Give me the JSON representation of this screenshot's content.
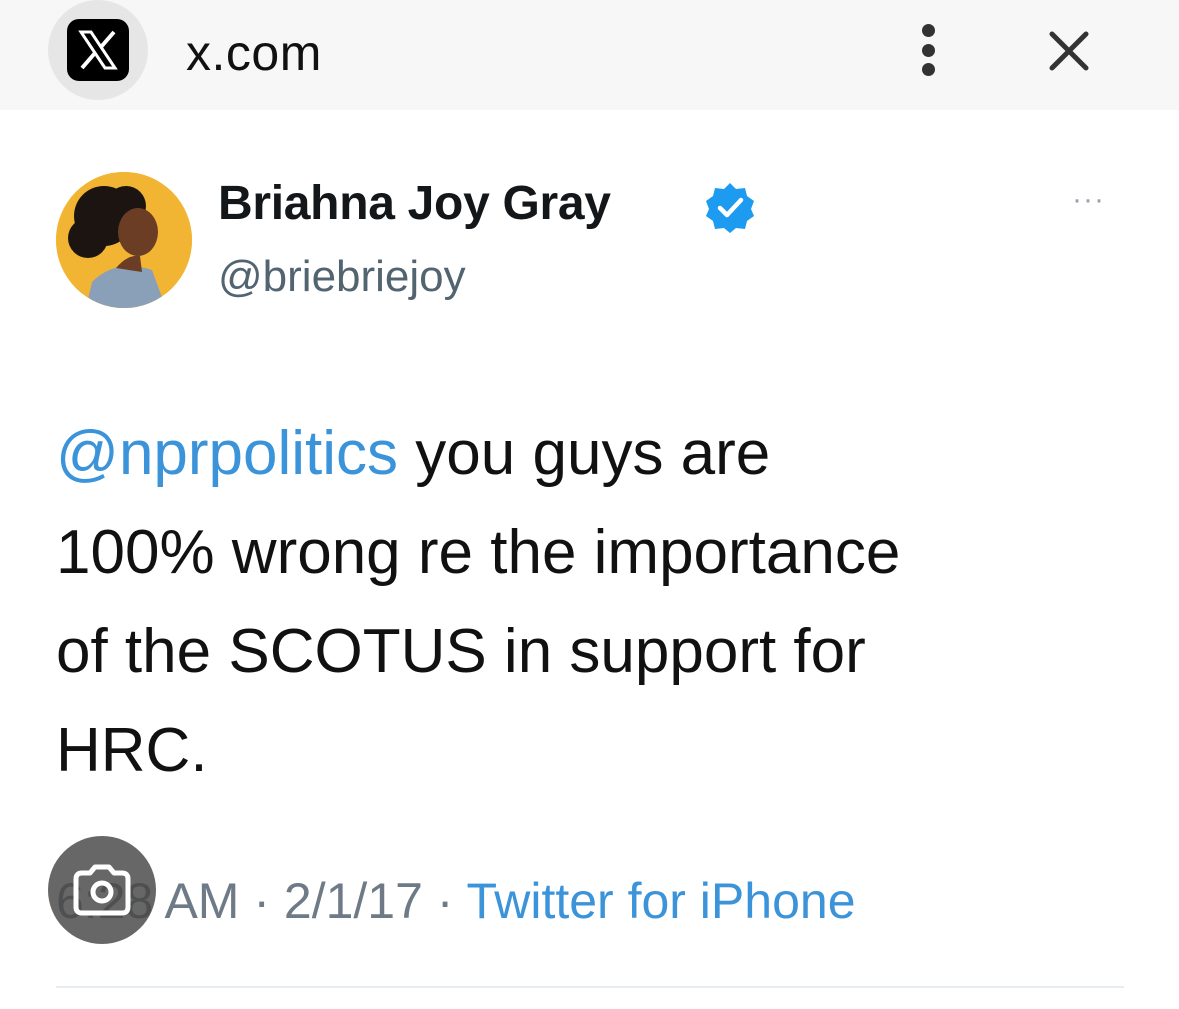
{
  "browser": {
    "domain": "x.com",
    "site_icon": "x-logo-icon",
    "menu_icon": "kebab-menu-icon",
    "close_icon": "close-icon"
  },
  "tweet": {
    "author_name": "Briahna Joy Gray",
    "author_handle": "@briebriejoy",
    "verified_icon": "verified-badge-icon",
    "more_label": "···",
    "mention": "@nprpolitics",
    "text": " you guys are\n100% wrong re the importance\nof the SCOTUS in support for\nHRC.",
    "time": "6:28 AM",
    "date": "2/1/17",
    "separator": " · ",
    "source": "Twitter for iPhone"
  },
  "overlay": {
    "lens_icon": "google-lens-icon"
  },
  "colors": {
    "link": "#3b93d9",
    "verified": "#1d9bf0",
    "muted": "#6e7b86"
  }
}
